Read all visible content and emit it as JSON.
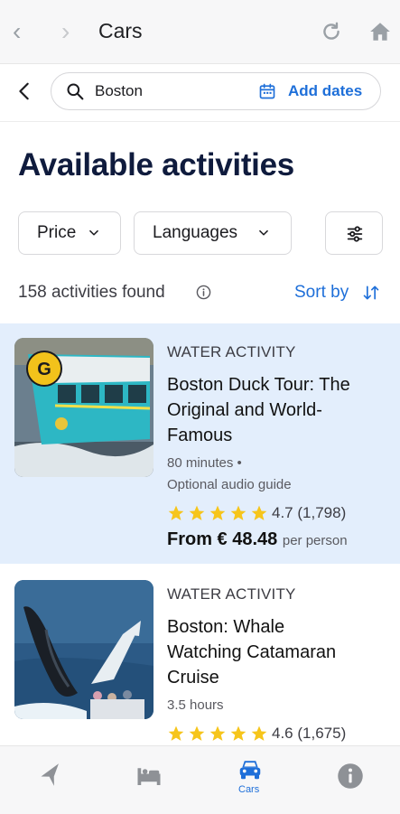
{
  "browser": {
    "title": "Cars"
  },
  "search": {
    "query": "Boston",
    "add_dates": "Add dates"
  },
  "heading": "Available activities",
  "filters": {
    "price": "Price",
    "languages": "Languages"
  },
  "results": {
    "count_text": "158 activities found",
    "sort_label": "Sort by"
  },
  "activities": [
    {
      "category": "WATER ACTIVITY",
      "title_lines": [
        "Boston Duck Tour: The",
        "Original and World-",
        "Famous"
      ],
      "duration": "80 minutes •",
      "extra": "Optional audio guide",
      "rating": "4.7",
      "reviews": "(1,798)",
      "price": "From € 48.48",
      "price_unit": "per person",
      "badge": "G"
    },
    {
      "category": "WATER ACTIVITY",
      "title_lines": [
        "Boston: Whale",
        "Watching Catamaran",
        "Cruise"
      ],
      "duration": "3.5 hours",
      "rating": "4.6",
      "reviews": "(1,675)"
    }
  ],
  "bottom_nav": {
    "cars_label": "Cars"
  },
  "colors": {
    "accent": "#1e6fd9",
    "highlight_card": "#e3eefc",
    "star": "#f6c51b"
  }
}
